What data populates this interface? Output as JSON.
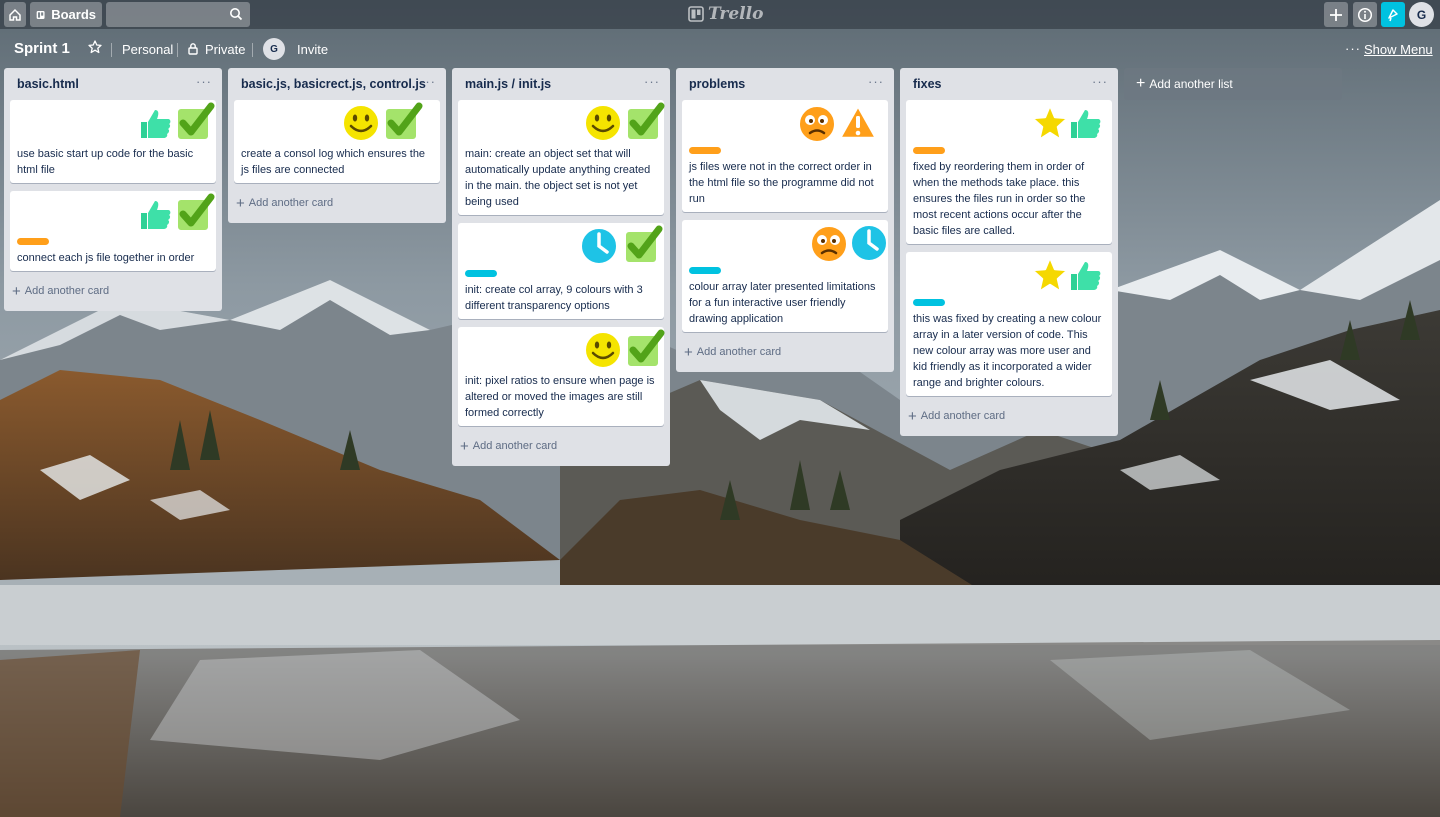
{
  "header": {
    "boards_label": "Boards",
    "search": {
      "value": "",
      "placeholder": ""
    },
    "logo_text": "Trello",
    "user_initial": "G"
  },
  "board": {
    "title": "Sprint 1",
    "team": "Personal",
    "visibility": "Private",
    "member_initial": "G",
    "invite_label": "Invite",
    "menu_dots": "···",
    "show_menu_label": "Show Menu"
  },
  "lists": [
    {
      "title": "basic.html",
      "add_card_label": "Add another card",
      "cards": [
        {
          "label": null,
          "text": "use basic start up code for the basic html file",
          "stickers": [
            "thumbsup-icon",
            "check-icon"
          ]
        },
        {
          "label": "orange",
          "text": "connect each js file together in order",
          "stickers": [
            "thumbsup-icon",
            "check-icon"
          ]
        }
      ]
    },
    {
      "title": "basic.js, basicrect.js, control.js",
      "add_card_label": "Add another card",
      "cards": [
        {
          "label": null,
          "text": "create a consol log which ensures the js files are connected",
          "stickers": [
            "smile-icon",
            "check-icon"
          ]
        }
      ]
    },
    {
      "title": "main.js / init.js",
      "add_card_label": "Add another card",
      "cards": [
        {
          "label": null,
          "text": "main: create an object set that will automatically update anything created in the main. the object set is not yet being used",
          "stickers": [
            "smile-icon",
            "check-icon"
          ]
        },
        {
          "label": "sky",
          "text": "init: create col array, 9 colours with 3 different transparency options",
          "stickers": [
            "clock-icon",
            "check-icon"
          ]
        },
        {
          "label": null,
          "text": "init: pixel ratios to ensure when page is altered or moved the images are still formed correctly",
          "stickers": [
            "smile-icon",
            "check-icon"
          ]
        }
      ]
    },
    {
      "title": "problems",
      "add_card_label": "Add another card",
      "cards": [
        {
          "label": "orange",
          "text": "js files were not in the correct order in the html file so the programme did not run",
          "stickers": [
            "frown-icon",
            "warning-icon"
          ]
        },
        {
          "label": "sky",
          "text": "colour array later presented limitations for a fun interactive user friendly drawing application",
          "stickers": [
            "frown-icon",
            "clock-icon"
          ]
        }
      ]
    },
    {
      "title": "fixes",
      "add_card_label": "Add another card",
      "cards": [
        {
          "label": "orange",
          "text": "fixed by reordering them in order of when the methods take place. this ensures the files run in order so the most recent actions occur after the basic files are called.",
          "stickers": [
            "star-icon",
            "thumbsup-icon"
          ]
        },
        {
          "label": "sky",
          "text": "this was fixed by creating a new colour array in a later version of code. This new colour array was more user and kid friendly as it incorporated a wider range and brighter colours.",
          "stickers": [
            "star-icon",
            "thumbsup-icon"
          ]
        }
      ]
    }
  ],
  "add_list_label": "Add another list",
  "colors": {
    "label_orange": "#ff9f1a",
    "label_sky": "#00c2e0",
    "list_bg": "#dfe1e6",
    "accent": "#00c2e0"
  }
}
